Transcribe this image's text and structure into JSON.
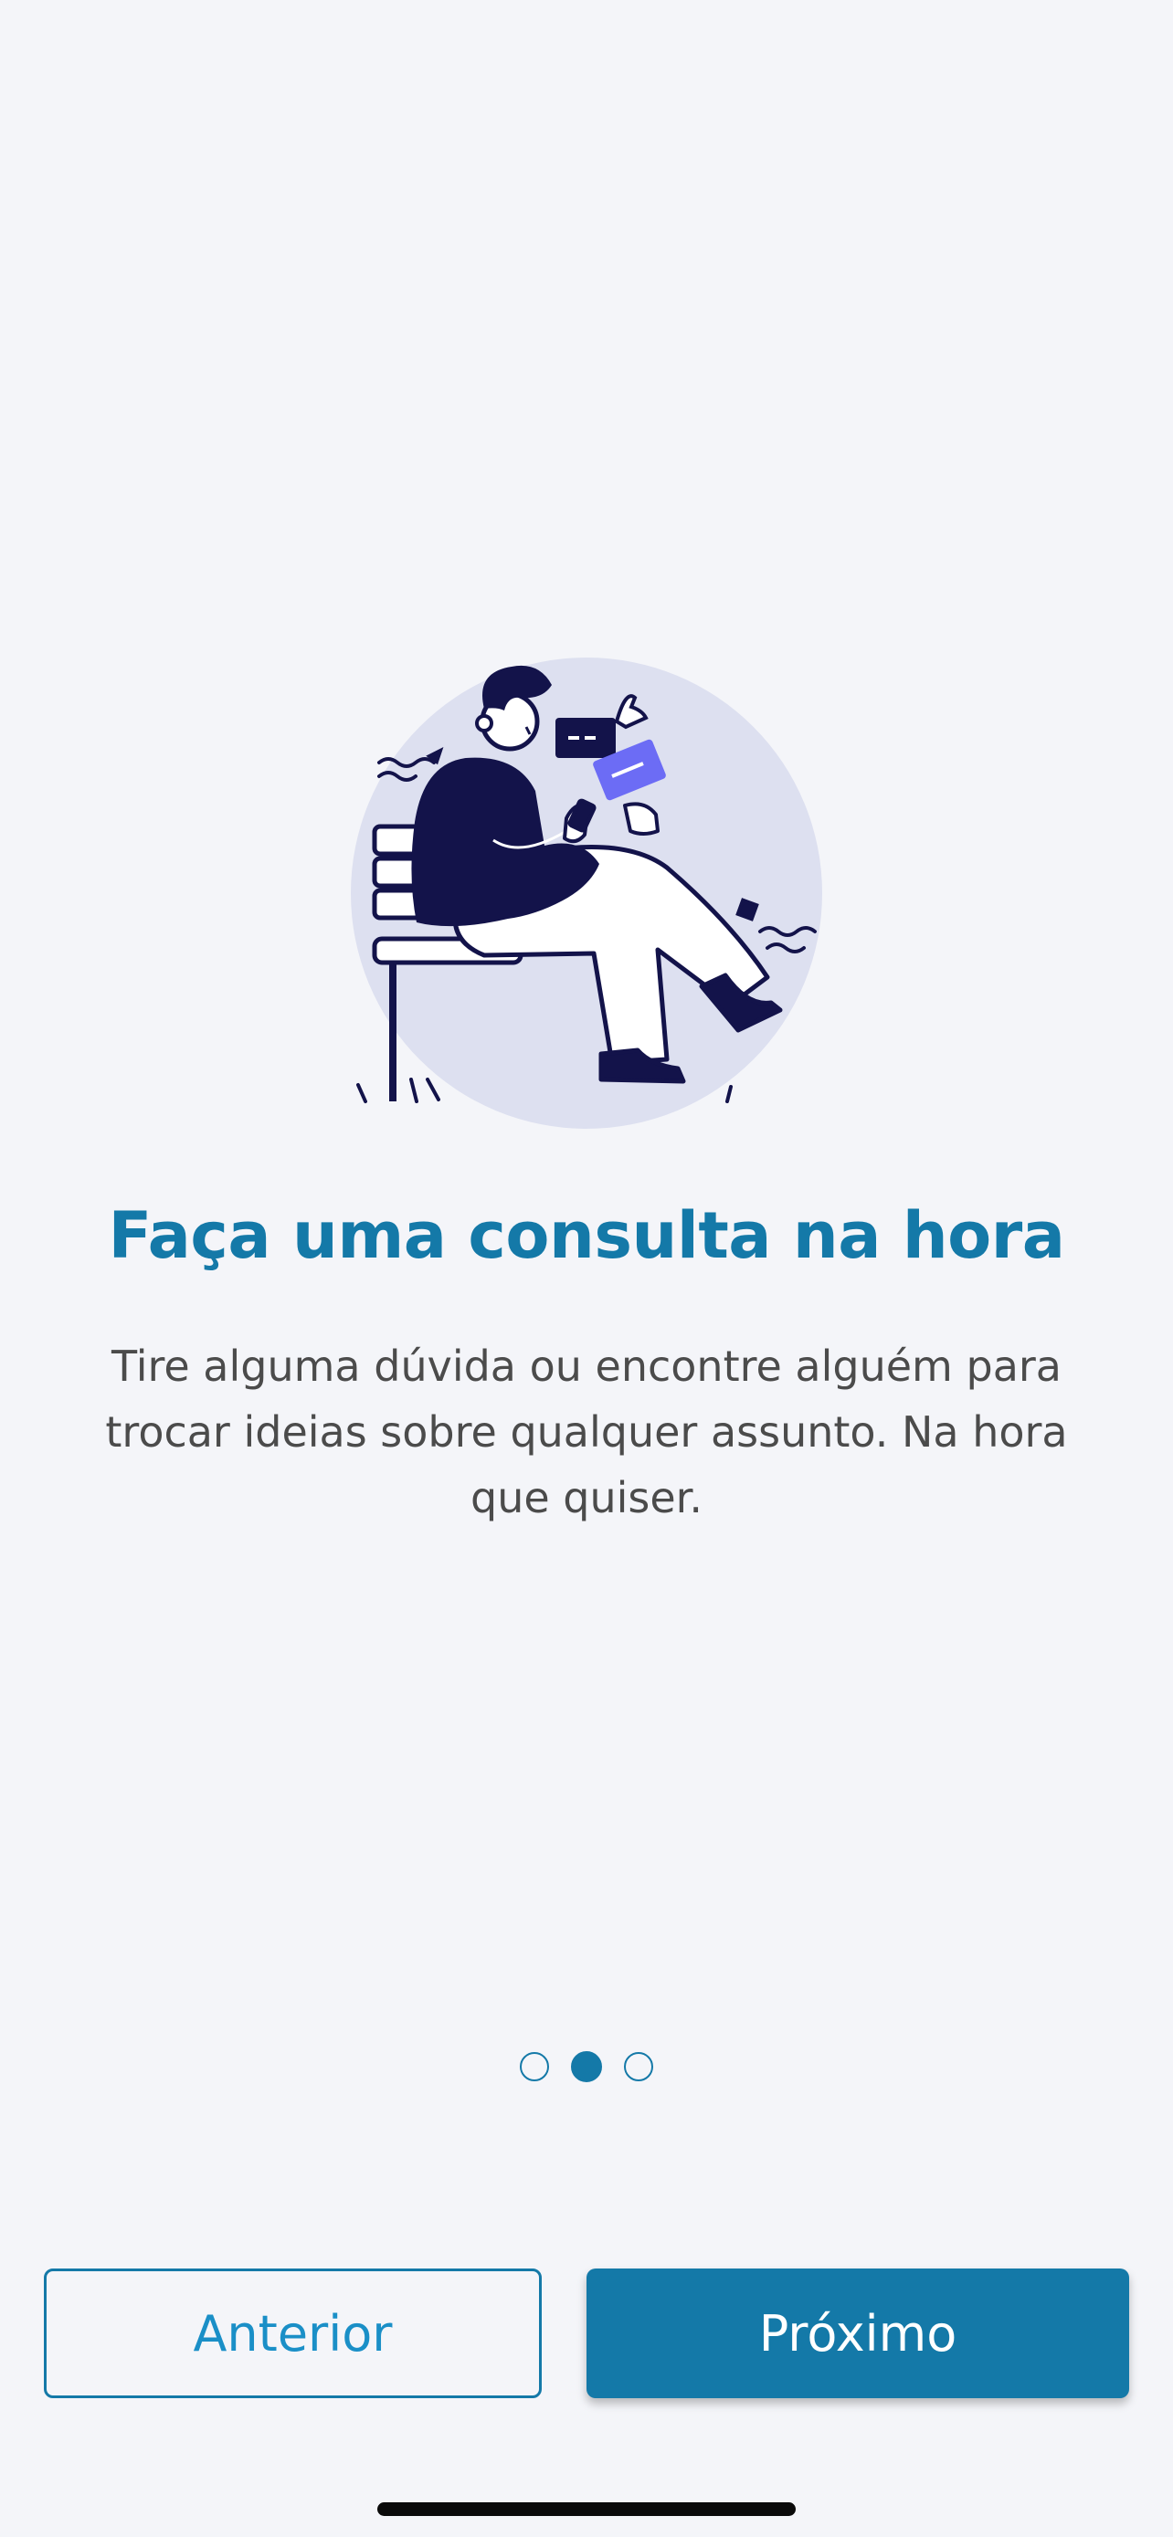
{
  "onboarding": {
    "title": "Faça uma consulta na hora",
    "description": "Tire alguma dúvida ou encontre alguém para trocar ideias sobre qualquer assunto. Na hora que quiser.",
    "illustration": "person-on-bench-with-phone",
    "pagination": {
      "total": 3,
      "current": 2
    }
  },
  "buttons": {
    "previous_label": "Anterior",
    "next_label": "Próximo"
  },
  "colors": {
    "accent": "#1479a8",
    "background": "#f4f5f9",
    "text": "#4b4b4b",
    "illustration_circle": "#dde0f0",
    "illustration_ink": "#13134a",
    "illustration_highlight": "#6c6cf5"
  }
}
